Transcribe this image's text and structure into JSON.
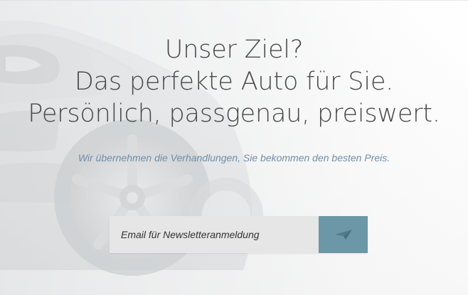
{
  "hero": {
    "line1": "Unser Ziel?",
    "line2": "Das perfekte Auto für Sie.",
    "line3": "Persönlich, passgenau, preiswert.",
    "subheadline": "Wir übernehmen die Verhandlungen, Sie bekommen den besten Preis."
  },
  "newsletter": {
    "placeholder": "Email für Newsletteranmeldung",
    "button_icon": "send-icon"
  },
  "colors": {
    "accent": "#6b97a7",
    "subheadline": "#6f8ea7",
    "text": "#4a4a4a",
    "input_background": "#e6e6e6"
  }
}
